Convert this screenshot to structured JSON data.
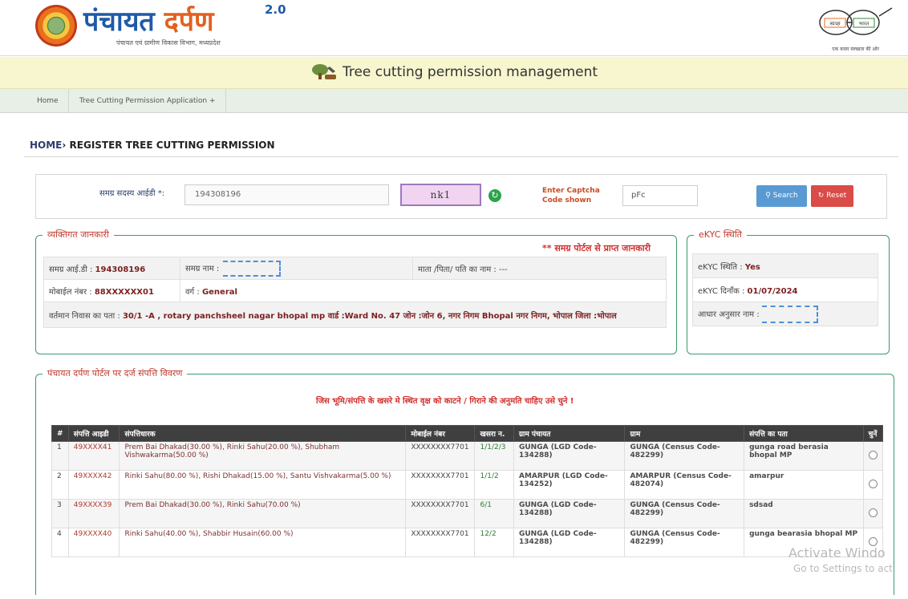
{
  "header": {
    "logo_title_part1": "पंचायत",
    "logo_title_part2": "दर्पण",
    "logo_version": "2.0",
    "logo_subtitle": "पंचायत एवं ग्रामीण विकास विभाग, मध्यप्रदेश",
    "sbm_word1": "स्वच्छ",
    "sbm_word2": "भारत",
    "sbm_caption": "एक कदम स्वच्छता की ओर"
  },
  "titlebar": {
    "title": "Tree cutting permission management",
    "icon": "tree-cutting-icon"
  },
  "nav": {
    "home": "Home",
    "application": "Tree Cutting Permission Application +"
  },
  "breadcrumb": {
    "home": "HOME",
    "separator": "›",
    "current": "REGISTER TREE CUTTING PERMISSION"
  },
  "search": {
    "member_label": "समग्र सदस्य आईडी *:",
    "member_value": "194308196",
    "captcha_text": "nk1",
    "captcha_label": "Enter Captcha Code shown",
    "captcha_value": "pFc",
    "search_label": "Search",
    "reset_label": "Reset"
  },
  "personal": {
    "legend": "व्यक्तिगत जानकारी",
    "portal_note": "** समग्र पोर्टल से प्राप्त जानकारी",
    "samagra_id_label": "समग्र आई.डी :",
    "samagra_id_value": "194308196",
    "samagra_name_label": "समग्र नाम :",
    "parent_label": "माता /पिता/ पति का नाम :",
    "parent_value": "---",
    "mobile_label": "मोबाईल नंबर :",
    "mobile_value": "88XXXXXX01",
    "category_label": "वर्ग :",
    "category_value": "General",
    "address_label": "वर्तमान निवास का पता :",
    "address_value": "30/1 -A , rotary panchsheel nagar bhopal mp वार्ड :Ward No. 47 जोन :जोन 6, नगर निगम Bhopal नगर निगम, भोपाल जिला :भोपाल"
  },
  "ekyc": {
    "legend": "eKYC स्थिति",
    "status_label": "eKYC स्थिति :",
    "status_value": "Yes",
    "date_label": "eKYC दिनाँक :",
    "date_value": "01/07/2024",
    "aadhaar_name_label": "आधार अनुसार नाम :"
  },
  "property": {
    "legend": "पंचायत दर्पण पोर्टल पर दर्ज संपत्ति विवरण",
    "note": "जिस भूमि/संपत्ति के खसरे मे स्थित वृक्ष को काटने / गिराने की अनुमति चाहिए उसे चुने !",
    "columns": [
      "#",
      "संपत्ति आइडी",
      "संपत्तिधारक",
      "मोबाईल नंबर",
      "खसरा न.",
      "ग्राम पंचायत",
      "ग्राम",
      "संपत्ति का पता",
      "चुनें"
    ],
    "rows": [
      {
        "n": "1",
        "id": "49XXXX41",
        "owner": "Prem Bai Dhakad(30.00 %), Rinki Sahu(20.00 %), Shubham Vishwakarma(50.00 %)",
        "mobile": "XXXXXXXX7701",
        "khasra": "1/1/2/3",
        "gp": "GUNGA (LGD Code-134288)",
        "gram": "GUNGA (Census Code-482299)",
        "addr": "gunga road berasia bhopal MP"
      },
      {
        "n": "2",
        "id": "49XXXX42",
        "owner": "Rinki Sahu(80.00 %), Rishi Dhakad(15.00 %), Santu Vishvakarma(5.00 %)",
        "mobile": "XXXXXXXX7701",
        "khasra": "1/1/2",
        "gp": "AMARPUR (LGD Code-134252)",
        "gram": "AMARPUR (Census Code-482074)",
        "addr": "amarpur"
      },
      {
        "n": "3",
        "id": "49XXXX39",
        "owner": "Prem Bai Dhakad(30.00 %), Rinki Sahu(70.00 %)",
        "mobile": "XXXXXXXX7701",
        "khasra": "6/1",
        "gp": "GUNGA (LGD Code-134288)",
        "gram": "GUNGA (Census Code-482299)",
        "addr": "sdsad"
      },
      {
        "n": "4",
        "id": "49XXXX40",
        "owner": "Rinki Sahu(40.00 %), Shabbir Husain(60.00 %)",
        "mobile": "XXXXXXXX7701",
        "khasra": "12/2",
        "gp": "GUNGA (LGD Code-134288)",
        "gram": "GUNGA (Census Code-482299)",
        "addr": "gunga bearasia bhopal MP"
      }
    ]
  },
  "watermark": {
    "line1": "Activate Windo",
    "line2": "Go to Settings to act"
  }
}
